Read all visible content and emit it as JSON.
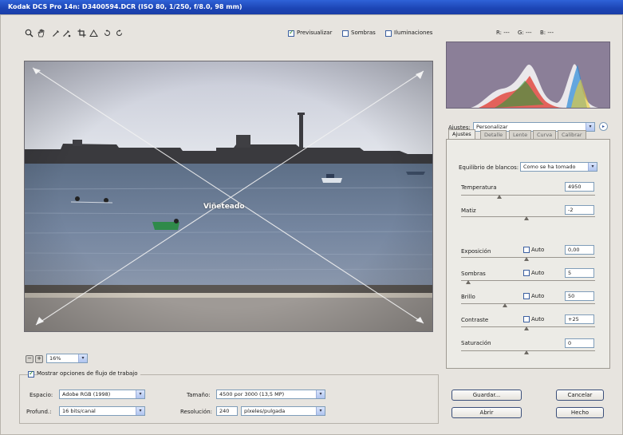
{
  "window": {
    "title": "Kodak DCS Pro 14n:  D3400594.DCR  (ISO 80, 1/250, f/8.0, 98 mm)"
  },
  "toolbar": {
    "tools": [
      {
        "icon": "zoom-icon",
        "glyph": "🔍"
      },
      {
        "icon": "hand-icon",
        "glyph": "✋"
      },
      {
        "icon": "eyedropper-icon",
        "glyph": "✒"
      },
      {
        "icon": "color-sampler-icon",
        "glyph": "✒"
      },
      {
        "icon": "crop-icon",
        "glyph": "⌗"
      },
      {
        "icon": "straighten-icon",
        "glyph": "△"
      },
      {
        "icon": "rotate-left-icon",
        "glyph": "○"
      },
      {
        "icon": "rotate-right-icon",
        "glyph": "○"
      }
    ],
    "preview_label": "Previsualizar",
    "preview_checked": true,
    "shadows_label": "Sombras",
    "shadows_checked": false,
    "highlights_label": "Iluminaciones",
    "highlights_checked": false,
    "rgb_r": "R: ---",
    "rgb_g": "G: ---",
    "rgb_b": "B: ---"
  },
  "preview": {
    "overlay_text": "Viñeteado"
  },
  "zoom": {
    "value": "16%"
  },
  "workflow": {
    "show_options_label": "Mostrar opciones de flujo de trabajo",
    "show_options_checked": true,
    "space_label": "Espacio:",
    "space_value": "Adobe RGB (1998)",
    "depth_label": "Profund.:",
    "depth_value": "16 bits/canal",
    "size_label": "Tamaño:",
    "size_value": "4500 por 3000  (13,5 MP)",
    "resolution_label": "Resolución:",
    "resolution_value": "240",
    "resolution_unit": "píxeles/pulgada"
  },
  "settings": {
    "label": "Ajustes:",
    "value": "Personalizar"
  },
  "tabs": [
    {
      "label": "Ajustes",
      "active": true
    },
    {
      "label": "Detalle",
      "active": false
    },
    {
      "label": "Lente",
      "active": false
    },
    {
      "label": "Curva",
      "active": false
    },
    {
      "label": "Calibrar",
      "active": false
    }
  ],
  "adjust": {
    "white_balance_label": "Equilibrio de blancos:",
    "white_balance_value": "Como se ha tomado",
    "temperature_label": "Temperatura",
    "temperature_value": "4950",
    "tint_label": "Matiz",
    "tint_value": "-2",
    "exposure_label": "Exposición",
    "exposure_value": "0,00",
    "shadows_label": "Sombras",
    "shadows_value": "5",
    "brightness_label": "Brillo",
    "brightness_value": "50",
    "contrast_label": "Contraste",
    "contrast_value": "+25",
    "saturation_label": "Saturación",
    "saturation_value": "0",
    "auto_label": "Auto"
  },
  "buttons": {
    "save": "Guardar...",
    "open": "Abrir",
    "cancel": "Cancelar",
    "done": "Hecho"
  },
  "colors": {
    "title_bar": "#1c44b4",
    "sky": "#d7dde6",
    "sea": "#6d7f95",
    "histogram_bg": "#8b7f98"
  }
}
